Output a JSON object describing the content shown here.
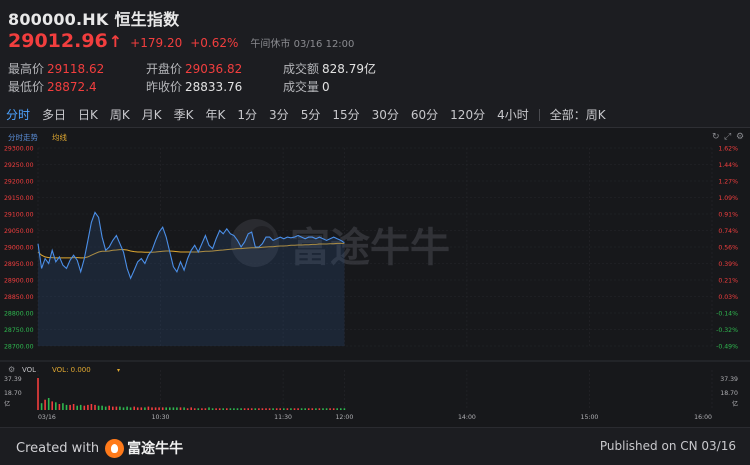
{
  "header": {
    "symbol": "800000.HK",
    "name": "恒生指数",
    "price": "29012.96",
    "change": "+179.20",
    "change_pct": "+0.62%",
    "status": "午间休市 03/16 12:00"
  },
  "stats": {
    "high_label": "最高价",
    "high_value": "29118.62",
    "low_label": "最低价",
    "low_value": "28872.4",
    "open_label": "开盘价",
    "open_value": "29036.82",
    "prev_label": "昨收价",
    "prev_value": "28833.76",
    "turnover_label": "成交额",
    "turnover_value": "828.79亿",
    "volume_label": "成交量",
    "volume_value": "0"
  },
  "tabs": [
    "分时",
    "多日",
    "日K",
    "周K",
    "月K",
    "季K",
    "年K",
    "1分",
    "3分",
    "5分",
    "15分",
    "30分",
    "60分",
    "120分",
    "4小时"
  ],
  "tab_right": "全部：周K",
  "chart": {
    "legend_price": "分时走势",
    "legend_avg": "均线",
    "watermark": "富途牛牛",
    "vol_label": "VOL",
    "vol_value_label": "VOL: 0.000",
    "vol_axis_left": [
      "37.39",
      "18.70",
      "亿"
    ],
    "vol_axis_right": [
      "37.39",
      "18.70",
      "亿"
    ],
    "colors": {
      "price_line": "#4b8fe8",
      "avg_line": "#e0a830",
      "up": "#f23e3e",
      "down": "#2fb84f"
    }
  },
  "chart_data": {
    "type": "line",
    "y_left": [
      "29300.00",
      "29250.00",
      "29200.00",
      "29150.00",
      "29100.00",
      "29050.00",
      "29000.00",
      "28950.00",
      "28900.00",
      "28850.00",
      "28800.00",
      "28750.00",
      "28700.00"
    ],
    "y_right": [
      "1.62%",
      "1.44%",
      "1.27%",
      "1.09%",
      "0.91%",
      "0.74%",
      "0.56%",
      "0.39%",
      "0.21%",
      "0.03%",
      "-0.14%",
      "-0.32%",
      "-0.49%"
    ],
    "x_ticks": [
      "03/16",
      "10:30",
      "11:30",
      "12:00",
      "14:00",
      "15:00",
      "16:00"
    ],
    "ylim": [
      28700,
      29300
    ],
    "series": [
      {
        "values": [
          29010,
          28935,
          28965,
          28950,
          28990,
          28955,
          28970,
          28945,
          28935,
          28960,
          28975,
          28960,
          28925,
          28965,
          29020,
          29075,
          29105,
          29090,
          29030,
          28990,
          29000,
          29020,
          29035,
          29010,
          28985,
          28935,
          28905,
          28930,
          28955,
          28965,
          28950,
          28975,
          28990,
          29020,
          29045,
          29060,
          29030,
          28985,
          28940,
          28925,
          28955,
          28930,
          28965,
          28990,
          29005,
          28985,
          29010,
          29035,
          29005,
          28995,
          29025,
          29050,
          29040,
          29055,
          29040,
          29035,
          29020,
          29000,
          29015,
          29040,
          29045,
          29000,
          29000,
          29010,
          29030,
          29030,
          29020,
          29025,
          29030,
          29025,
          29030,
          29028,
          29030,
          29035,
          29030,
          29025,
          29030,
          29030,
          29025,
          29030,
          29025,
          29020,
          29025,
          29030,
          29025,
          29020,
          29013
        ]
      },
      {
        "values": [
          28985,
          28975,
          28970,
          28968,
          28968,
          28967,
          28967,
          28967,
          28967,
          28967,
          28968,
          28968,
          28967,
          28967,
          28970,
          28975,
          28980,
          28985,
          28987,
          28987,
          28988,
          28990,
          28991,
          28992,
          28992,
          28991,
          28988,
          28986,
          28985,
          28985,
          28984,
          28984,
          28984,
          28985,
          28986,
          28987,
          28988,
          28988,
          28987,
          28986,
          28985,
          28985,
          28985,
          28985,
          28985,
          28985,
          28986,
          28987,
          28987,
          28988,
          28989,
          28990,
          28991,
          28992,
          28993,
          28994,
          28995,
          28995,
          28996,
          28997,
          28998,
          28998,
          28998,
          28999,
          29000,
          29001,
          29001,
          29002,
          29003,
          29003,
          29004,
          29005,
          29005,
          29006,
          29006,
          29007,
          29007,
          29008,
          29008,
          29009,
          29009,
          29009,
          29010,
          29010,
          29011,
          29011,
          29011
        ]
      }
    ],
    "volumes": [
      37.4,
      8,
      12,
      14,
      10,
      9,
      7,
      8,
      6,
      6,
      7,
      5,
      6,
      5,
      6,
      7,
      6,
      5,
      5,
      4,
      5,
      4,
      4,
      4,
      3,
      4,
      3,
      4,
      3,
      3,
      3,
      4,
      3,
      3,
      3,
      3,
      3,
      3,
      3,
      3,
      3,
      3,
      2,
      3,
      2,
      2,
      2,
      2,
      3,
      2,
      2,
      2,
      2,
      2,
      2,
      2,
      2,
      2,
      2,
      2,
      2,
      2,
      2,
      2,
      2,
      2,
      2,
      2,
      2,
      2,
      2,
      2,
      2,
      2,
      2,
      2,
      2,
      2,
      2,
      2,
      2,
      2,
      2,
      2,
      2,
      2,
      2
    ],
    "volume_ylim": [
      0,
      37.39
    ]
  },
  "footer": {
    "created_with": "Created with",
    "brand": "富途牛牛",
    "published": "Published on CN 03/16"
  }
}
